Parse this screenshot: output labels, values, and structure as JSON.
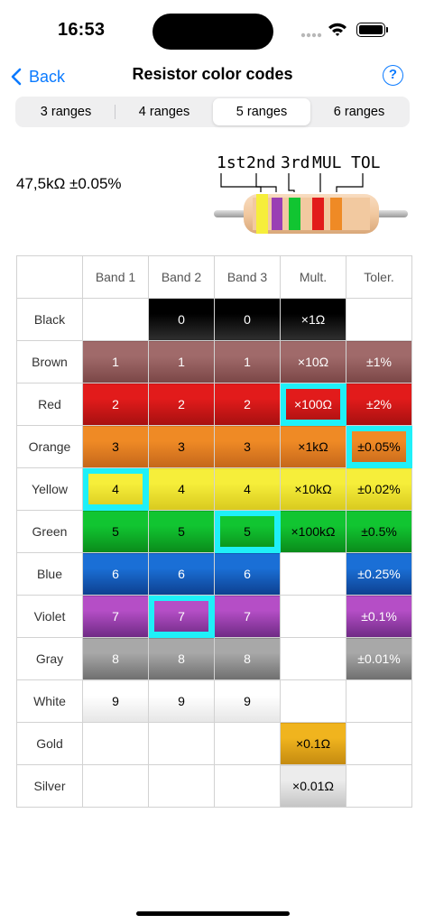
{
  "status_bar": {
    "time": "16:53",
    "signal_icon": "signal-dots-icon",
    "wifi_icon": "wifi-icon",
    "battery_icon": "battery-icon"
  },
  "nav": {
    "back_label": "Back",
    "title": "Resistor color codes",
    "help_label": "?"
  },
  "segments": {
    "items": [
      "3 ranges",
      "4 ranges",
      "5 ranges",
      "6 ranges"
    ],
    "selected": "5 ranges"
  },
  "value": "47,5kΩ ±0.05%",
  "diagram": {
    "labels": [
      "1st",
      "2nd",
      "3rd",
      "MUL",
      "TOL"
    ],
    "band_colors": [
      "#f6ee3a",
      "#9a3fb4",
      "#11c531",
      "#e21b1b",
      "#ef8a25"
    ],
    "body_color": "#f2c9a0",
    "lead_color": "#b8b8b8"
  },
  "table": {
    "headers": [
      "",
      "Band 1",
      "Band 2",
      "Band 3",
      "Mult.",
      "Toler."
    ],
    "rows": [
      {
        "name": "Black",
        "color": "#000000",
        "dark": "#303030",
        "text": "#ffffff",
        "cells": [
          "",
          "0",
          "0",
          "×1Ω",
          ""
        ]
      },
      {
        "name": "Brown",
        "color": "#a06a6a",
        "dark": "#7a4646",
        "text": "#ffffff",
        "cells": [
          "1",
          "1",
          "1",
          "×10Ω",
          "±1%"
        ]
      },
      {
        "name": "Red",
        "color": "#e21b1b",
        "dark": "#a61010",
        "text": "#ffffff",
        "cells": [
          "2",
          "2",
          "2",
          "×100Ω",
          "±2%"
        ]
      },
      {
        "name": "Orange",
        "color": "#ef8a25",
        "dark": "#c4661b",
        "text": "#000000",
        "cells": [
          "3",
          "3",
          "3",
          "×1kΩ",
          "±0.05%"
        ]
      },
      {
        "name": "Yellow",
        "color": "#f6ee3a",
        "dark": "#d8c91e",
        "text": "#000000",
        "cells": [
          "4",
          "4",
          "4",
          "×10kΩ",
          "±0.02%"
        ]
      },
      {
        "name": "Green",
        "color": "#11c531",
        "dark": "#0a8a1a",
        "text": "#000000",
        "cells": [
          "5",
          "5",
          "5",
          "×100kΩ",
          "±0.5%"
        ]
      },
      {
        "name": "Blue",
        "color": "#1a6fd6",
        "dark": "#0d3f8f",
        "text": "#ffffff",
        "cells": [
          "6",
          "6",
          "6",
          "",
          "±0.25%"
        ]
      },
      {
        "name": "Violet",
        "color": "#b54ec6",
        "dark": "#6e2a84",
        "text": "#ffffff",
        "cells": [
          "7",
          "7",
          "7",
          "",
          "±0.1%"
        ]
      },
      {
        "name": "Gray",
        "color": "#a8a8a8",
        "dark": "#6e6e6e",
        "text": "#ffffff",
        "cells": [
          "8",
          "8",
          "8",
          "",
          "±0.01%"
        ]
      },
      {
        "name": "White",
        "color": "#ffffff",
        "dark": "#e6e6e6",
        "text": "#000000",
        "cells": [
          "9",
          "9",
          "9",
          "",
          ""
        ]
      },
      {
        "name": "Gold",
        "color": "#f0b41e",
        "dark": "#c48a10",
        "text": "#000000",
        "cells": [
          "",
          "",
          "",
          "×0.1Ω",
          ""
        ]
      },
      {
        "name": "Silver",
        "color": "#ececec",
        "dark": "#c4c4c4",
        "text": "#000000",
        "cells": [
          "",
          "",
          "",
          "×0.01Ω",
          ""
        ]
      }
    ],
    "selected": [
      {
        "row": "Yellow",
        "column": "Band 1"
      },
      {
        "row": "Violet",
        "column": "Band 2"
      },
      {
        "row": "Green",
        "column": "Band 3"
      },
      {
        "row": "Red",
        "column": "Mult."
      },
      {
        "row": "Orange",
        "column": "Toler."
      }
    ],
    "highlight_color": "#1ff0f8"
  }
}
